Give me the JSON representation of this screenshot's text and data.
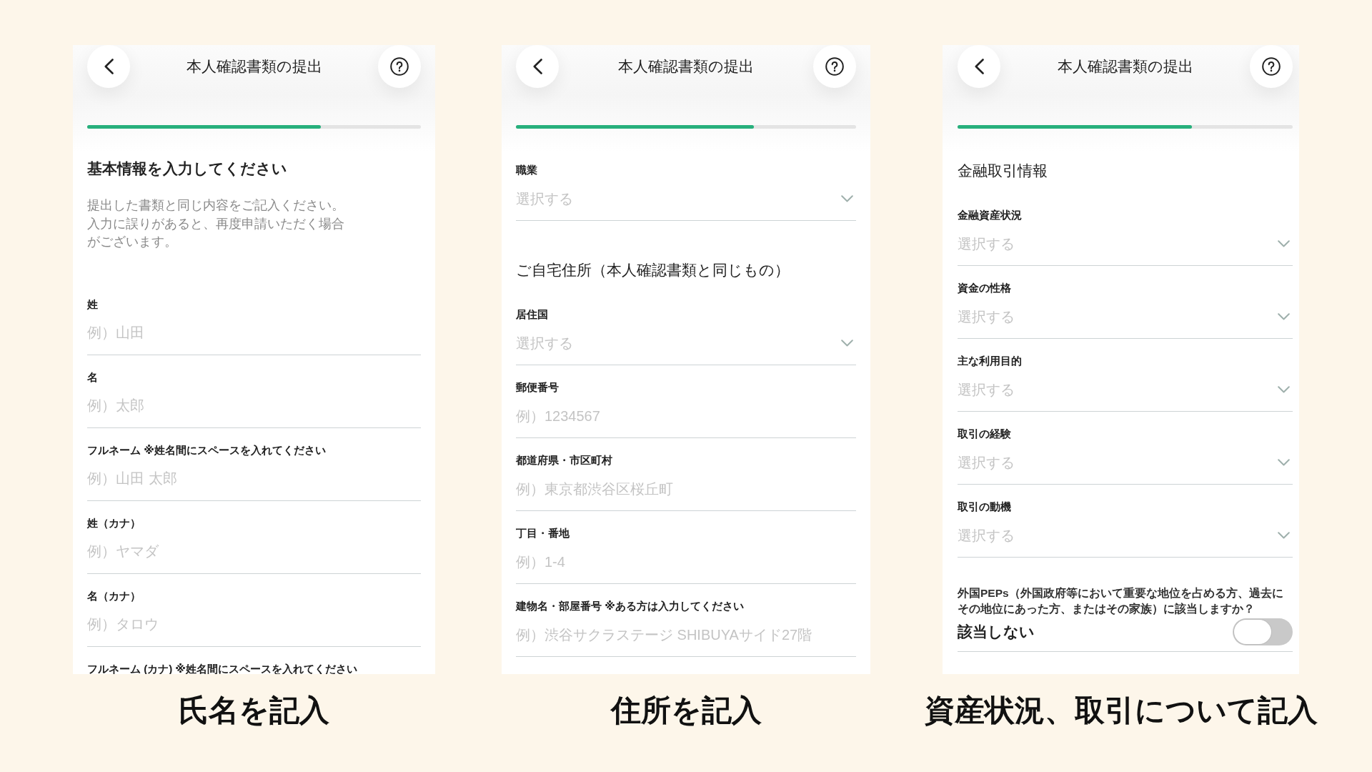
{
  "panels": [
    {
      "header": {
        "title": "本人確認書類の提出"
      },
      "progress": {
        "level": 0.7
      },
      "blocks": [
        {
          "kind": "heading",
          "text": "基本情報を入力してください"
        },
        {
          "kind": "note",
          "text": "提出した書類と同じ内容をご記入ください。入力に誤りがあると、再度申請いただく場合がございます。"
        },
        {
          "kind": "text",
          "label": "姓",
          "placeholder": "例）山田"
        },
        {
          "kind": "text",
          "label": "名",
          "placeholder": "例）太郎"
        },
        {
          "kind": "text",
          "label": "フルネーム ※姓名間にスペースを入れてください",
          "placeholder": "例）山田 太郎"
        },
        {
          "kind": "text",
          "label": "姓（カナ）",
          "placeholder": "例）ヤマダ"
        },
        {
          "kind": "text",
          "label": "名（カナ）",
          "placeholder": "例）タロウ"
        },
        {
          "kind": "text",
          "label": "フルネーム (カナ) ※姓名間にスペースを入れてください"
        }
      ],
      "caption": "氏名を記入"
    },
    {
      "header": {
        "title": "本人確認書類の提出"
      },
      "progress": {
        "level": 0.7
      },
      "blocks": [
        {
          "kind": "select",
          "label": "職業",
          "placeholder": "選択する"
        },
        {
          "kind": "section",
          "text": "ご自宅住所（本人確認書類と同じもの）"
        },
        {
          "kind": "select",
          "label": "居住国",
          "placeholder": "選択する"
        },
        {
          "kind": "text",
          "label": "郵便番号",
          "placeholder": "例）1234567"
        },
        {
          "kind": "text",
          "label": "都道府県・市区町村",
          "placeholder": "例）東京都渋谷区桜丘町"
        },
        {
          "kind": "text",
          "label": "丁目・番地",
          "placeholder": "例）1-4"
        },
        {
          "kind": "text",
          "label": "建物名・部屋番号 ※ある方は入力してください",
          "placeholder": "例）渋谷サクラステージ SHIBUYAサイド27階"
        }
      ],
      "caption": "住所を記入"
    },
    {
      "header": {
        "title": "本人確認書類の提出"
      },
      "progress": {
        "level": 0.7
      },
      "blocks": [
        {
          "kind": "section",
          "text": "金融取引情報"
        },
        {
          "kind": "select",
          "label": "金融資産状況",
          "placeholder": "選択する"
        },
        {
          "kind": "select",
          "label": "資金の性格",
          "placeholder": "選択する"
        },
        {
          "kind": "select",
          "label": "主な利用目的",
          "placeholder": "選択する"
        },
        {
          "kind": "select",
          "label": "取引の経験",
          "placeholder": "選択する"
        },
        {
          "kind": "select",
          "label": "取引の動機",
          "placeholder": "選択する"
        },
        {
          "kind": "toggle",
          "question": "外国PEPs（外国政府等において重要な地位を占める方、過去にその地位にあった方、またはその家族）に該当しますか？",
          "label": "該当しない",
          "on": false
        }
      ],
      "caption": "資産状況、取引について記入"
    }
  ]
}
